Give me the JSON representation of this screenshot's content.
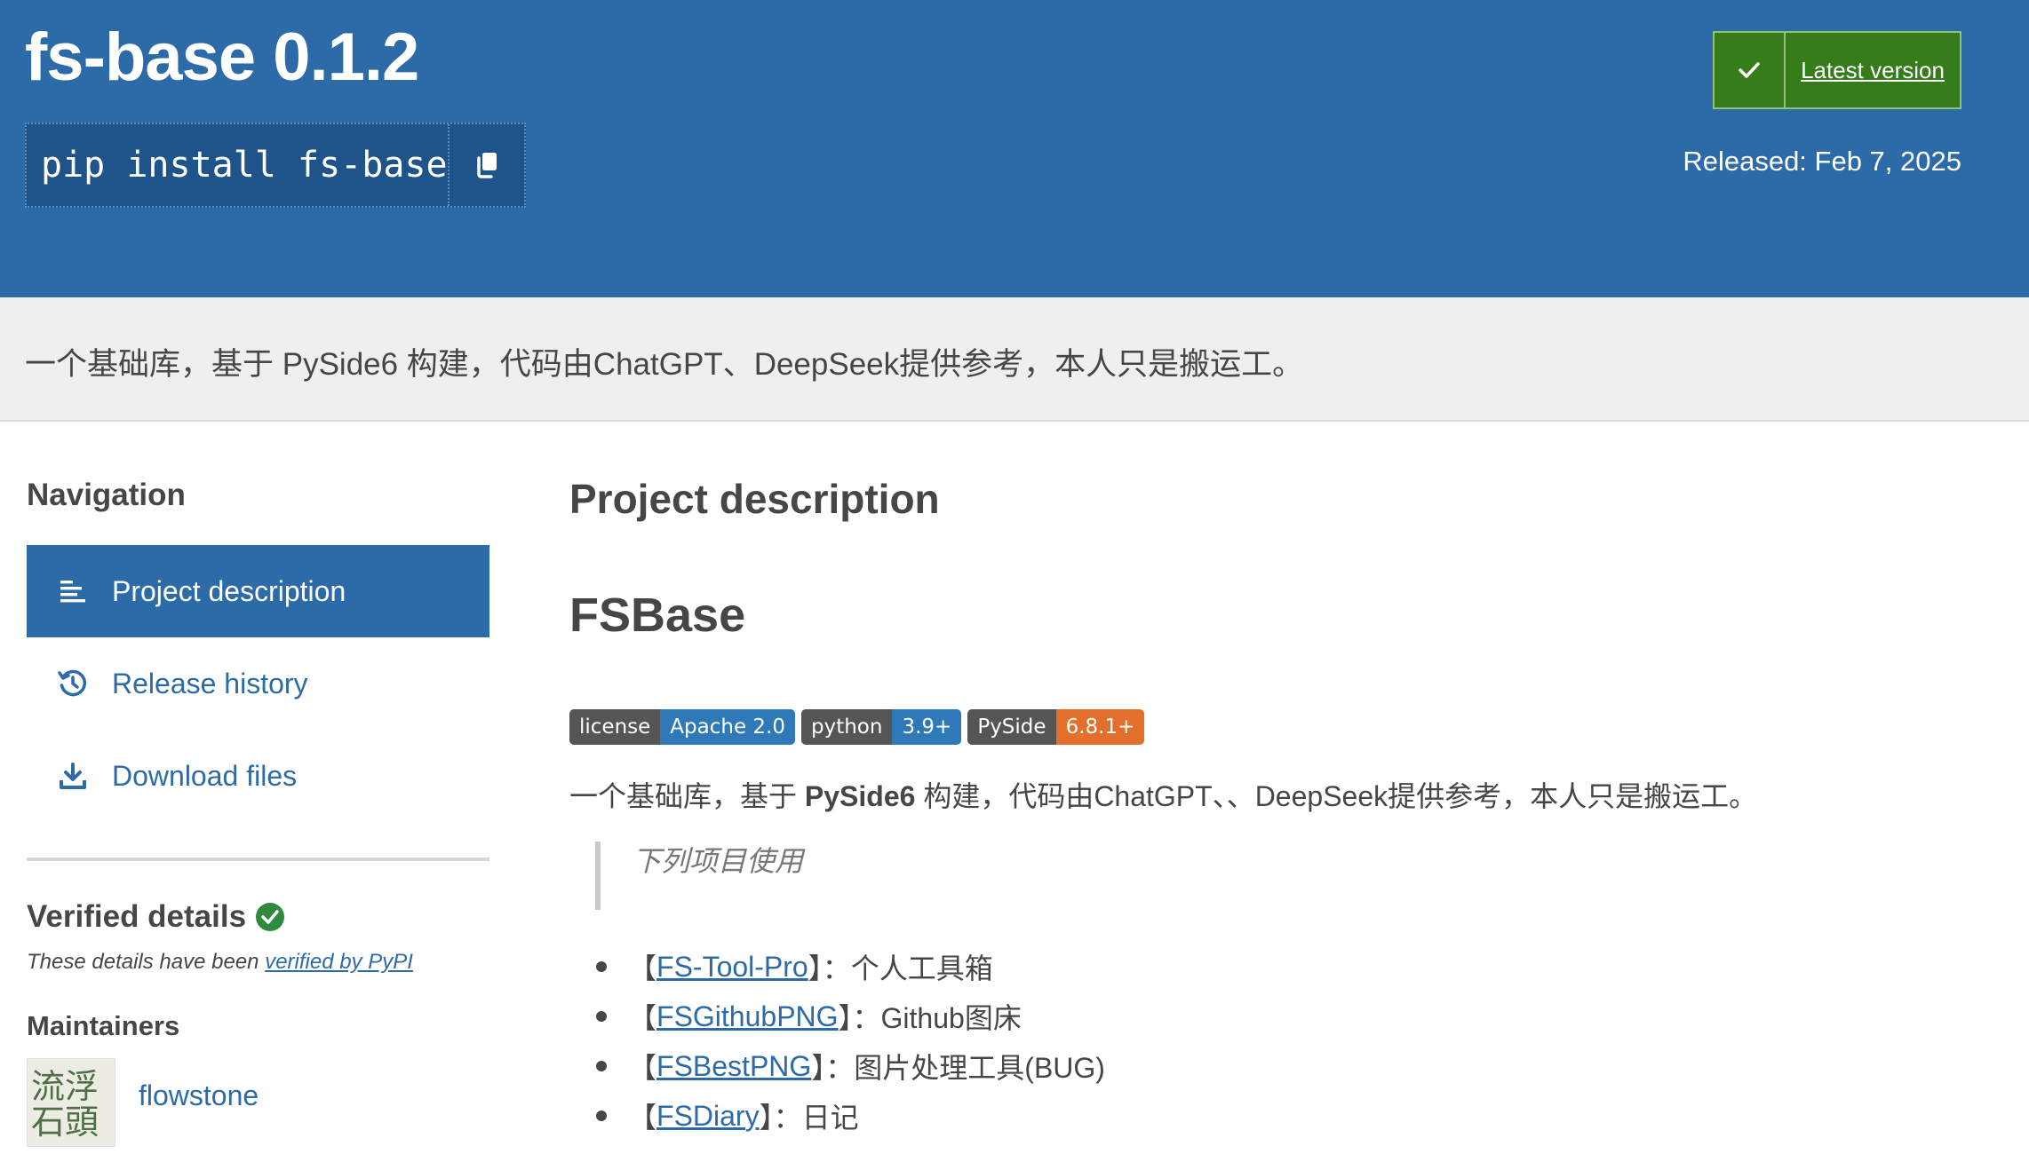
{
  "header": {
    "title": "fs-base 0.1.2",
    "pip_command": "pip install fs-base",
    "latest_version_label": "Latest version",
    "released": "Released: Feb 7, 2025",
    "colors": {
      "banner": "#2c6aa8",
      "latest_badge": "#367c1a"
    }
  },
  "summary": "一个基础库，基于 PySide6 构建，代码由ChatGPT、DeepSeek提供参考，本人只是搬运工。",
  "sidebar": {
    "navigation_heading": "Navigation",
    "items": [
      {
        "label": "Project description",
        "icon": "align-left-icon",
        "active": true
      },
      {
        "label": "Release history",
        "icon": "history-icon",
        "active": false
      },
      {
        "label": "Download files",
        "icon": "download-icon",
        "active": false
      }
    ],
    "verified_heading": "Verified details",
    "verified_note_prefix": "These details have been ",
    "verified_note_link": "verified by PyPI",
    "maintainers_heading": "Maintainers",
    "maintainer": {
      "name": "flowstone",
      "avatar_text": "流浮石頭"
    }
  },
  "main": {
    "section_heading": "Project description",
    "doc_title": "FSBase",
    "badges": [
      {
        "key": "license",
        "value": "Apache 2.0",
        "color": "#2f79b8"
      },
      {
        "key": "python",
        "value": "3.9+",
        "color": "#2f79b8"
      },
      {
        "key": "PySide",
        "value": "6.8.1+",
        "color": "#e26f2b"
      }
    ],
    "description_prefix": "一个基础库，基于 ",
    "description_bold": "PySide6",
    "description_suffix": " 构建，代码由ChatGPT、、DeepSeek提供参考，本人只是搬运工。",
    "quote": "下列项目使用",
    "links": [
      {
        "open": "【",
        "name": "FS-Tool-Pro",
        "rest": "】：个人工具箱"
      },
      {
        "open": "【",
        "name": "FSGithubPNG",
        "rest": "】：Github图床"
      },
      {
        "open": "【",
        "name": "FSBestPNG",
        "rest": "】：图片处理工具(BUG)"
      },
      {
        "open": "【",
        "name": "FSDiary",
        "rest": "】：日记"
      }
    ]
  }
}
